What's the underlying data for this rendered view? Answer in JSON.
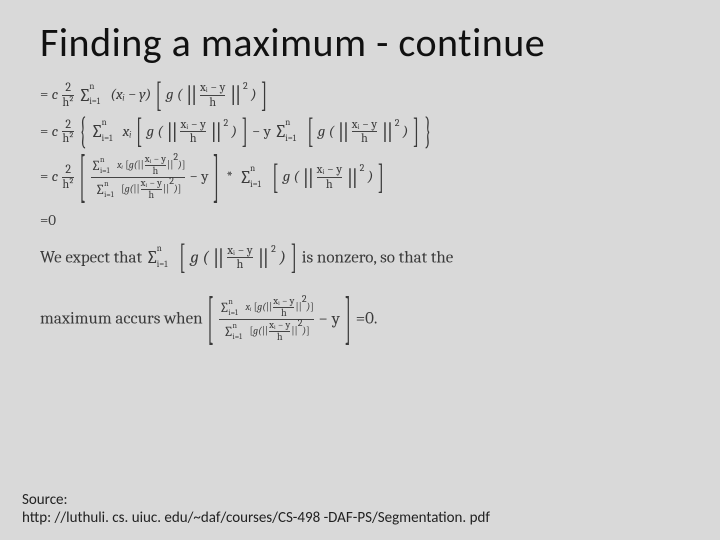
{
  "title": "Finding a maximum - continue",
  "glyph": {
    "sigma": "∑",
    "lbracket": "[",
    "rbracket": "]",
    "lbrace": "{",
    "rbrace": "}",
    "norm": "||",
    "star": "*"
  },
  "math": {
    "eq_lead": "= ",
    "c": "c",
    "two_over_h2_num": "2",
    "two_over_h2_den": "h²",
    "sum_lo": "i=1",
    "sum_hi": "n",
    "x_minus_y": "(xᵢ − y)",
    "g_open": "g (",
    "g_close": ")",
    "inner_num": "xᵢ − y",
    "inner_den": "h",
    "sq": "2",
    "xi": "xᵢ",
    "minus_y_outer": " − y ",
    "minus_y_end": " − y",
    "eq_zero": "=0",
    "eq_zero_end": "=0.",
    "text_expect_a": "We expect that ",
    "text_expect_b": " is nonzero, so that the",
    "text_max": "maximum accurs when "
  },
  "source": {
    "label": "Source:",
    "url": "http: //luthuli. cs. uiuc. edu/~daf/courses/CS-498 -DAF-PS/Segmentation. pdf"
  }
}
